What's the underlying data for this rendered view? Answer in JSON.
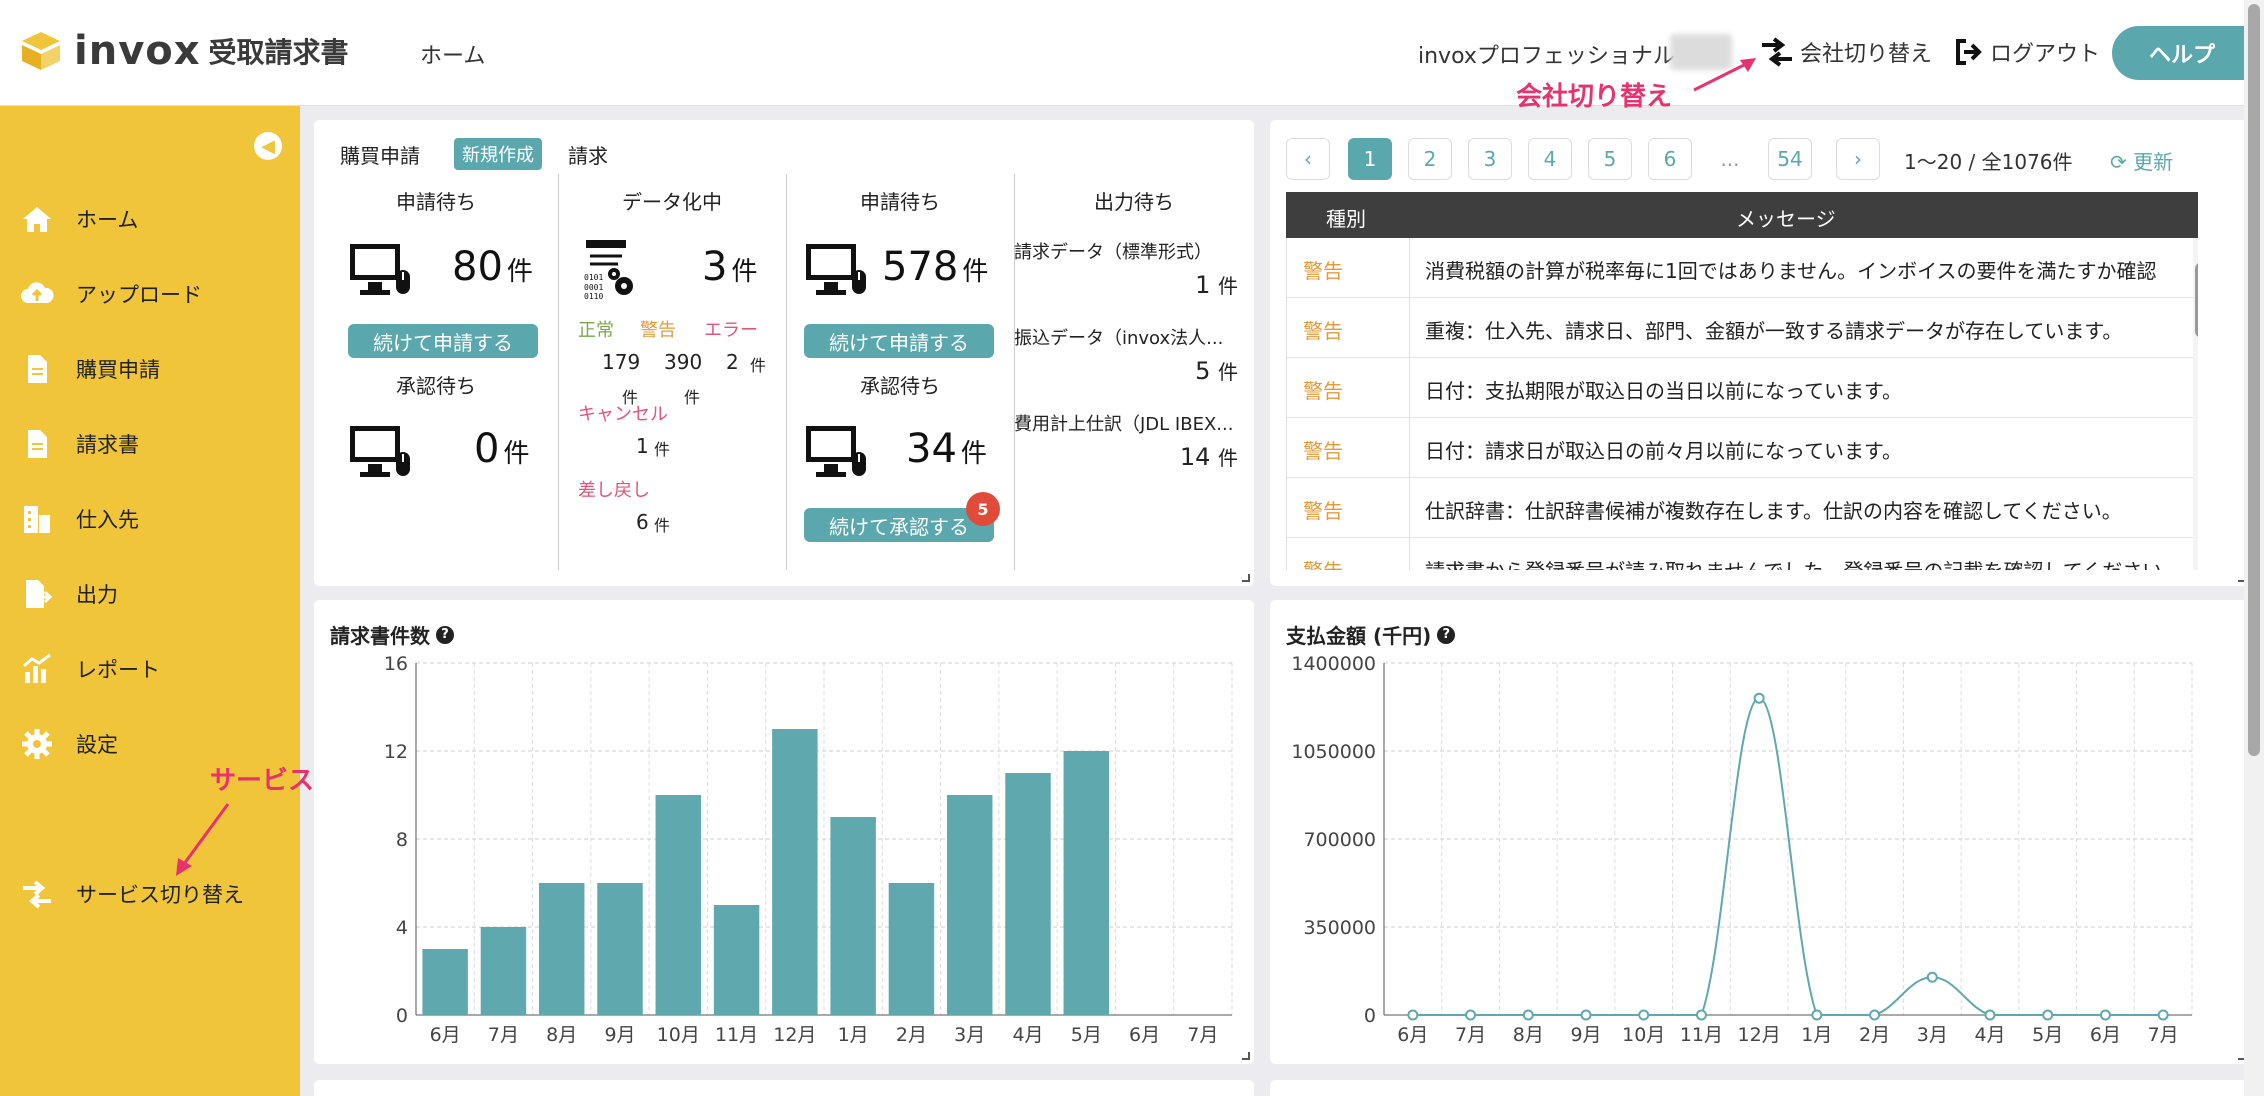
{
  "header": {
    "logo_text": "invox",
    "logo_sub": "受取請求書",
    "nav_home": "ホーム",
    "company_name": "invoxプロフェッショナル",
    "switch_company": "会社切り替え",
    "logout": "ログアウト",
    "help": "ヘルプ"
  },
  "annotations": {
    "company_switch": "会社切り替え",
    "service_switch": "サービス切り替え"
  },
  "sidebar": {
    "items": [
      {
        "label": "ホーム",
        "icon": "home-icon"
      },
      {
        "label": "アップロード",
        "icon": "cloud-upload-icon"
      },
      {
        "label": "購買申請",
        "icon": "document-icon"
      },
      {
        "label": "請求書",
        "icon": "document-icon"
      },
      {
        "label": "仕入先",
        "icon": "building-icon"
      },
      {
        "label": "出力",
        "icon": "export-icon"
      },
      {
        "label": "レポート",
        "icon": "chart-icon"
      },
      {
        "label": "設定",
        "icon": "gear-icon"
      },
      {
        "label": "サービス切り替え",
        "icon": "switch-icon"
      }
    ]
  },
  "summary": {
    "purchase_label": "購買申請",
    "new_badge": "新規作成",
    "invoice_label": "請求",
    "purchase": {
      "pending_title": "申請待ち",
      "pending_count": "80",
      "unit": "件",
      "pending_button": "続けて申請する",
      "approval_title": "承認待ち",
      "approval_count": "0"
    },
    "datafy": {
      "title": "データ化中",
      "count": "3",
      "normal_label": "正常",
      "warning_label": "警告",
      "error_label": "エラー",
      "normal_count": "179",
      "warning_count": "390",
      "error_count": "2",
      "cancel_label": "キャンセル",
      "cancel_count": "1",
      "return_label": "差し戻し",
      "return_count": "6"
    },
    "invoice": {
      "pending_title": "申請待ち",
      "pending_count": "578",
      "pending_button": "続けて申請する",
      "approval_title": "承認待ち",
      "approval_count": "34",
      "approval_button": "続けて承認する",
      "approval_badge": "5"
    },
    "output": {
      "title": "出力待ち",
      "items": [
        {
          "label": "請求データ（標準形式）",
          "count": "1"
        },
        {
          "label": "振込データ（invox法人...",
          "count": "5"
        },
        {
          "label": "費用計上仕訳（JDL IBEX...",
          "count": "14"
        }
      ]
    }
  },
  "messages": {
    "pages": [
      "1",
      "2",
      "3",
      "4",
      "5",
      "6",
      "...",
      "54"
    ],
    "info": "1〜20 / 全1076件",
    "refresh": "更新",
    "col_kind": "種別",
    "col_message": "メッセージ",
    "rows": [
      {
        "kind": "警告",
        "text": "消費税額の計算が税率毎に1回ではありません。インボイスの要件を満たすか確認"
      },
      {
        "kind": "警告",
        "text": "重複：仕入先、請求日、部門、金額が一致する請求データが存在しています。"
      },
      {
        "kind": "警告",
        "text": "日付：支払期限が取込日の当日以前になっています。"
      },
      {
        "kind": "警告",
        "text": "日付：請求日が取込日の前々月以前になっています。"
      },
      {
        "kind": "警告",
        "text": "仕訳辞書：仕訳辞書候補が複数存在します。仕訳の内容を確認してください。"
      },
      {
        "kind": "警告",
        "text": "請求書から登録番号が読み取れませんでした。登録番号の記載を確認してください"
      }
    ]
  },
  "chart_data": [
    {
      "type": "bar",
      "title": "請求書件数",
      "categories": [
        "6月",
        "7月",
        "8月",
        "9月",
        "10月",
        "11月",
        "12月",
        "1月",
        "2月",
        "3月",
        "4月",
        "5月",
        "6月",
        "7月"
      ],
      "values": [
        3,
        4,
        6,
        6,
        10,
        5,
        13,
        9,
        6,
        10,
        11,
        12,
        0,
        0
      ],
      "yticks": [
        "0",
        "4",
        "8",
        "12",
        "16"
      ],
      "ylim": [
        0,
        16
      ],
      "color": "#5fa8ae",
      "grid": true
    },
    {
      "type": "line",
      "title": "支払金額 (千円)",
      "categories": [
        "6月",
        "7月",
        "8月",
        "9月",
        "10月",
        "11月",
        "12月",
        "1月",
        "2月",
        "3月",
        "4月",
        "5月",
        "6月",
        "7月"
      ],
      "values": [
        0,
        0,
        0,
        0,
        0,
        0,
        1260000,
        0,
        0,
        150000,
        0,
        0,
        0,
        0
      ],
      "yticks": [
        "0",
        "350000",
        "700000",
        "1050000",
        "1400000"
      ],
      "ylim": [
        0,
        1400000
      ],
      "color": "#5fa8ae",
      "grid": true
    }
  ]
}
